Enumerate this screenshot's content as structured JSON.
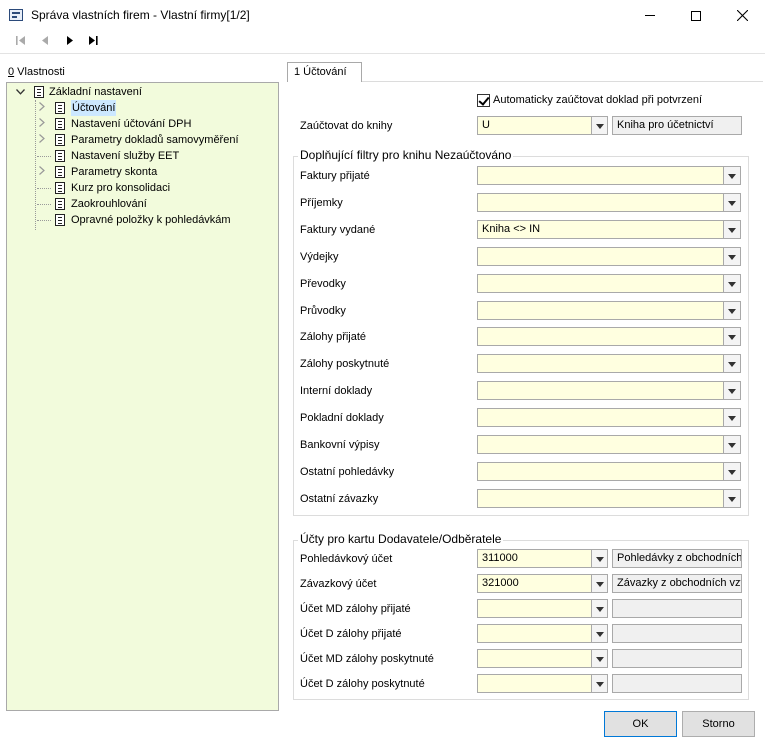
{
  "window": {
    "title": "Správa vlastních firem - Vlastní firmy[1/2]"
  },
  "nav": {
    "first": "first-record-icon",
    "prev": "previous-record-icon",
    "next": "next-record-icon",
    "last": "last-record-icon"
  },
  "left_panel": {
    "label_prefix": "0",
    "label_rest": " Vlastnosti",
    "root": "Základní nastavení",
    "items": [
      "Účtování",
      "Nastavení účtování DPH",
      "Parametry dokladů samovyměření",
      "Nastavení služby EET",
      "Parametry skonta",
      "Kurz pro konsolidaci",
      "Zaokrouhlování",
      "Opravné položky k pohledávkám"
    ]
  },
  "tab": {
    "label": "1 Účtování"
  },
  "auto_post": {
    "label": "Automaticky zaúčtovat doklad při potvrzení",
    "checked": true
  },
  "book": {
    "label": "Zaúčtovat do knihy",
    "value": "U",
    "description": "Kniha pro účetnictví"
  },
  "filters": {
    "title": "Doplňující filtry pro knihu Nezaúčtováno",
    "rows": [
      {
        "label": "Faktury přijaté",
        "value": ""
      },
      {
        "label": "Příjemky",
        "value": ""
      },
      {
        "label": "Faktury vydané",
        "value": "Kniha <> IN"
      },
      {
        "label": "Výdejky",
        "value": ""
      },
      {
        "label": "Převodky",
        "value": ""
      },
      {
        "label": "Průvodky",
        "value": ""
      },
      {
        "label": "Zálohy přijaté",
        "value": ""
      },
      {
        "label": "Zálohy poskytnuté",
        "value": ""
      },
      {
        "label": "Interní doklady",
        "value": ""
      },
      {
        "label": "Pokladní doklady",
        "value": ""
      },
      {
        "label": "Bankovní výpisy",
        "value": ""
      },
      {
        "label": "Ostatní pohledávky",
        "value": ""
      },
      {
        "label": "Ostatní závazky",
        "value": ""
      }
    ]
  },
  "accounts": {
    "title": "Účty pro kartu Dodavatele/Odběratele",
    "rows": [
      {
        "label": "Pohledávkový účet",
        "value": "311000",
        "description": "Pohledávky z obchodních vztahů"
      },
      {
        "label": "Závazkový účet",
        "value": "321000",
        "description": "Závazky z obchodních vztahů"
      },
      {
        "label": "Účet MD zálohy přijaté",
        "value": "",
        "description": ""
      },
      {
        "label": "Účet D zálohy přijaté",
        "value": "",
        "description": ""
      },
      {
        "label": "Účet MD zálohy poskytnuté",
        "value": "",
        "description": ""
      },
      {
        "label": "Účet D zálohy poskytnuté",
        "value": "",
        "description": ""
      }
    ]
  },
  "buttons": {
    "ok": "OK",
    "cancel": "Storno"
  },
  "colors": {
    "tree_bg": "#f2fbdc",
    "field_bg": "#ffffe0",
    "selection": "#cce8ff",
    "ok_border": "#0078d7"
  }
}
